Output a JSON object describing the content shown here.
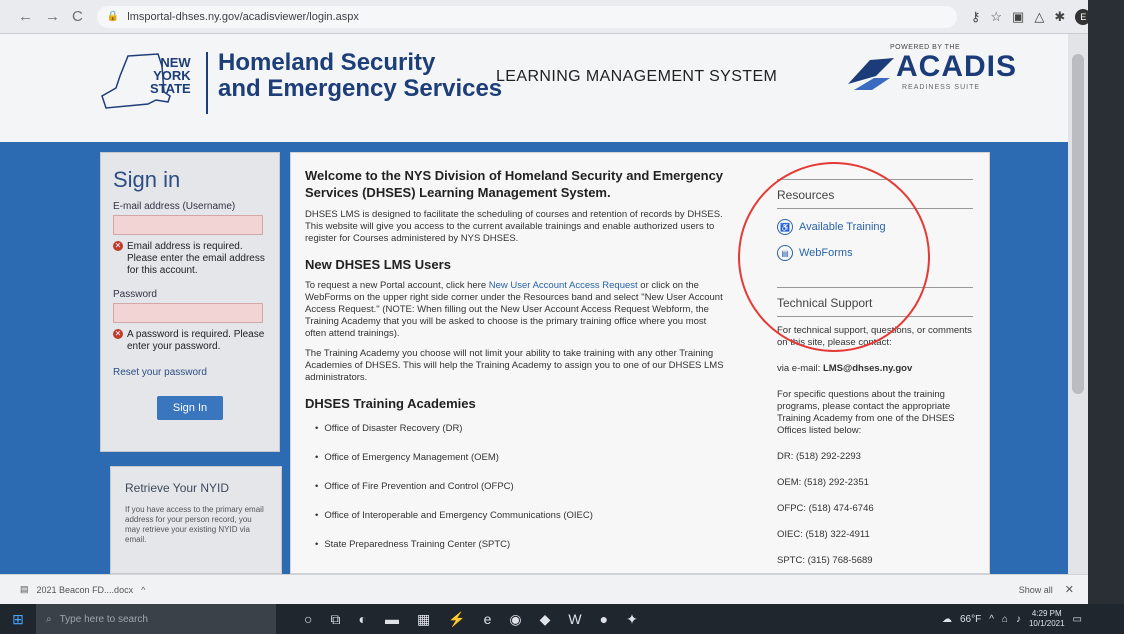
{
  "browser": {
    "url": "lmsportal-dhses.ny.gov/acadisviewer/login.aspx"
  },
  "header": {
    "state_logo": [
      "NEW",
      "YORK",
      "STATE"
    ],
    "agency_line1": "Homeland Security",
    "agency_line2": "and Emergency Services",
    "system_name": "LEARNING MANAGEMENT SYSTEM",
    "powered_by": "POWERED BY THE",
    "acadis": "ACADIS",
    "readiness": "READINESS SUITE"
  },
  "signin": {
    "title": "Sign in",
    "email_label": "E-mail address (Username)",
    "email_error": "Email address is required. Please enter the email address for this account.",
    "password_label": "Password",
    "password_error": "A password is required. Please enter your password.",
    "reset": "Reset your password",
    "button": "Sign In"
  },
  "retrieve": {
    "title": "Retrieve Your NYID",
    "text": "If you have access to the primary email address for your person record, you may retrieve your existing NYID via email."
  },
  "main": {
    "welcome": "Welcome to the NYS Division of Homeland Security and Emergency Services (DHSES) Learning Management System.",
    "intro": "DHSES LMS is designed to facilitate the scheduling of courses and retention of records by DHSES. This website will give you access to the current available trainings and enable authorized users to register for Courses administered by NYS DHSES.",
    "new_users_heading": "New DHSES LMS Users",
    "new_users_pre": "To request a new Portal account, click here ",
    "new_users_link": "New User Account Access Request",
    "new_users_post": " or click on the WebForms on the upper right side corner under the Resources band and select \"New User Account Access Request.\" (NOTE: When filling out the New User Account Access Request Webform, the Training Academy that you will be asked to choose is the primary training office where you most often attend trainings).",
    "academy_note": "The Training Academy you choose will not limit your ability to take training with any other Training Academies of DHSES. This will help the Training Academy to assign you to one of our DHSES LMS administrators.",
    "academies_heading": "DHSES Training Academies",
    "academies": [
      "Office of Disaster Recovery (DR)",
      "Office of Emergency Management (OEM)",
      "Office of Fire Prevention and Control (OFPC)",
      "Office of Interoperable and Emergency Communications (OIEC)",
      "State Preparedness Training Center (SPTC)"
    ]
  },
  "resources": {
    "title": "Resources",
    "available_training": "Available Training",
    "webforms": "WebForms"
  },
  "tech": {
    "title": "Technical Support",
    "intro": "For technical support, questions, or comments on this site, please contact:",
    "email_pre": "via e-mail: ",
    "email": "LMS@dhses.ny.gov",
    "specific": "For specific questions about the training programs, please contact the appropriate Training Academy from one of the DHSES Offices listed below:",
    "phones": [
      "DR: (518) 292-2293",
      "OEM: (518) 292-2351",
      "OFPC: (518) 474-6746",
      "OIEC: (518) 322-4911",
      "SPTC: (315) 768-5689"
    ]
  },
  "download": {
    "file": "2021 Beacon FD....docx",
    "show_all": "Show all"
  },
  "taskbar": {
    "search": "Type here to search",
    "temp": "66°F",
    "time": "4:29 PM",
    "date": "10/1/2021"
  }
}
